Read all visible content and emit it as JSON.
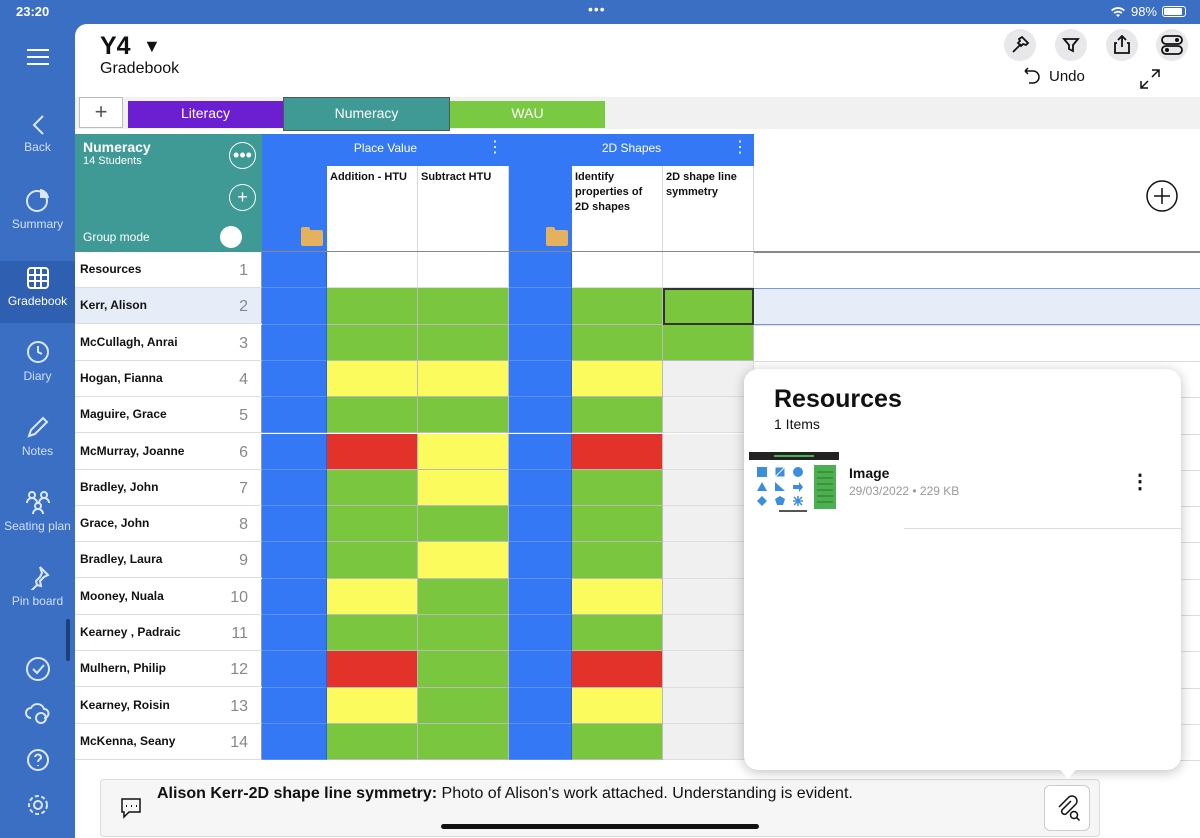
{
  "status": {
    "time": "23:20",
    "battery": "98%"
  },
  "sidebar": {
    "items": [
      {
        "label": "Back",
        "icon": "chevron-left-icon"
      },
      {
        "label": "Summary",
        "icon": "pie-chart-icon"
      },
      {
        "label": "Gradebook",
        "icon": "grid-icon"
      },
      {
        "label": "Diary",
        "icon": "clock-icon"
      },
      {
        "label": "Notes",
        "icon": "pencil-icon"
      },
      {
        "label": "Seating plan",
        "icon": "people-icon"
      },
      {
        "label": "Pin board",
        "icon": "pin-icon"
      }
    ]
  },
  "header": {
    "class_name": "Y4",
    "subtitle": "Gradebook",
    "undo_label": "Undo"
  },
  "tabs": [
    {
      "label": "Literacy",
      "color": "#6b1fd0"
    },
    {
      "label": "Numeracy",
      "color": "#3f9a95"
    },
    {
      "label": "WAU",
      "color": "#7ac943"
    }
  ],
  "group": {
    "name": "Numeracy",
    "students": "14 Students",
    "mode_label": "Group mode"
  },
  "column_groups": [
    {
      "label": "Place Value"
    },
    {
      "label": "2D Shapes"
    }
  ],
  "columns": [
    {
      "label": "Addition - HTU"
    },
    {
      "label": "Subtract HTU"
    },
    {
      "label": "Identify properties of 2D shapes"
    },
    {
      "label": "2D shape line symmetry"
    }
  ],
  "rows": [
    {
      "name": "Resources",
      "num": "1",
      "grades": [
        "",
        "",
        "",
        ""
      ]
    },
    {
      "name": "Kerr, Alison",
      "num": "2",
      "grades": [
        "green",
        "green",
        "green",
        "green"
      ]
    },
    {
      "name": "McCullagh, Anrai",
      "num": "3",
      "grades": [
        "green",
        "green",
        "green",
        "green"
      ]
    },
    {
      "name": "Hogan, Fianna",
      "num": "4",
      "grades": [
        "yellow",
        "yellow",
        "yellow",
        ""
      ]
    },
    {
      "name": "Maguire, Grace",
      "num": "5",
      "grades": [
        "green",
        "green",
        "green",
        ""
      ]
    },
    {
      "name": "McMurray, Joanne",
      "num": "6",
      "grades": [
        "red",
        "yellow",
        "red",
        ""
      ]
    },
    {
      "name": "Bradley, John",
      "num": "7",
      "grades": [
        "green",
        "yellow",
        "green",
        ""
      ]
    },
    {
      "name": "Grace, John",
      "num": "8",
      "grades": [
        "green",
        "green",
        "green",
        ""
      ]
    },
    {
      "name": "Bradley, Laura",
      "num": "9",
      "grades": [
        "green",
        "yellow",
        "green",
        ""
      ]
    },
    {
      "name": "Mooney, Nuala",
      "num": "10",
      "grades": [
        "yellow",
        "green",
        "yellow",
        ""
      ]
    },
    {
      "name": "Kearney , Padraic",
      "num": "11",
      "grades": [
        "green",
        "green",
        "green",
        ""
      ]
    },
    {
      "name": "Mulhern, Philip",
      "num": "12",
      "grades": [
        "red",
        "green",
        "red",
        ""
      ]
    },
    {
      "name": "Kearney, Roisin",
      "num": "13",
      "grades": [
        "yellow",
        "green",
        "yellow",
        ""
      ]
    },
    {
      "name": "McKenna, Seany",
      "num": "14",
      "grades": [
        "green",
        "green",
        "green",
        ""
      ]
    }
  ],
  "grade_colors": {
    "green": "#7ac63e",
    "yellow": "#fcfb5e",
    "red": "#e3322a"
  },
  "resources": {
    "title": "Resources",
    "count": "1 Items",
    "items": [
      {
        "name": "Image",
        "meta": "29/03/2022 • 229 KB"
      }
    ]
  },
  "comment": {
    "title": "Alison Kerr-2D shape line symmetry:",
    "text": " Photo of Alison's work attached. Understanding is evident."
  }
}
